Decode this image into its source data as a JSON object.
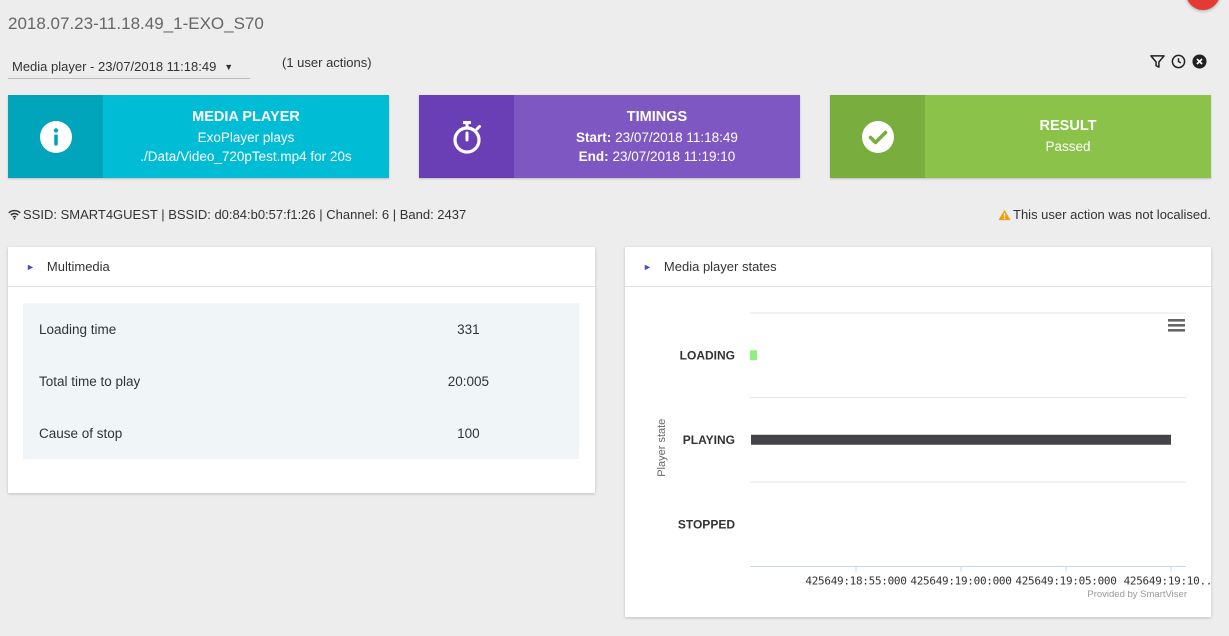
{
  "page": {
    "title": "2018.07.23-11.18.49_1-EXO_S70"
  },
  "header": {
    "player_select": "Media player - 23/07/2018 11:18:49",
    "user_actions": "(1 user actions)",
    "icons": [
      "filter-icon",
      "clock-icon",
      "close-circle-icon"
    ]
  },
  "cards": {
    "media": {
      "title": "MEDIA PLAYER",
      "line1": "ExoPlayer plays",
      "line2": "./Data/Video_720pTest.mp4 for 20s",
      "color": "#00bcd4",
      "icon": "info-icon"
    },
    "timings": {
      "title": "TIMINGS",
      "start_label": "Start:",
      "start_value": "23/07/2018 11:18:49",
      "end_label": "End:",
      "end_value": "23/07/2018 11:19:10",
      "color": "#7e57c2",
      "icon": "stopwatch-icon"
    },
    "result": {
      "title": "RESULT",
      "value": "Passed",
      "color": "#8bc34a",
      "icon": "check-circle-icon"
    }
  },
  "network": {
    "text": "SSID: SMART4GUEST | BSSID: d0:84:b0:57:f1:26 | Channel: 6 | Band: 2437"
  },
  "warning": {
    "text": "This user action was not localised.",
    "color": "#f39c12"
  },
  "multimedia": {
    "header": "Multimedia",
    "rows": [
      {
        "label": "Loading time",
        "value": "331"
      },
      {
        "label": "Total time to play",
        "value": "20:005"
      },
      {
        "label": "Cause of stop",
        "value": "100"
      }
    ]
  },
  "states_panel": {
    "header": "Media player states",
    "credit": "Provided by SmartViser"
  },
  "chart_data": {
    "type": "gantt",
    "ylabel": "Player state",
    "categories": [
      "LOADING",
      "PLAYING",
      "STOPPED"
    ],
    "x_ticks": [
      "425649:18:55:000",
      "425649:19:00:000",
      "425649:19:05:000",
      "425649:19:10..."
    ],
    "series": [
      {
        "category": "LOADING",
        "start": "425649:18:49:000",
        "end": "425649:18:49:331",
        "color": "#90ee7e"
      },
      {
        "category": "PLAYING",
        "start": "425649:18:50:000",
        "end": "425649:19:10:000",
        "color": "#434348"
      }
    ]
  }
}
